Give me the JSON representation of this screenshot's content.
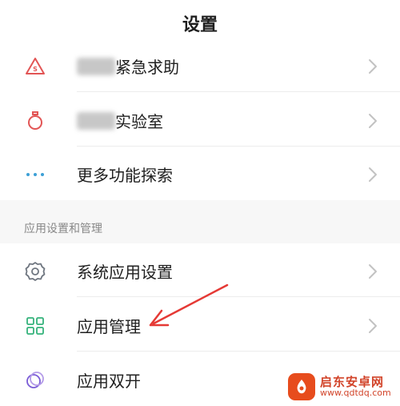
{
  "header": {
    "title": "设置"
  },
  "top_group": {
    "items": [
      {
        "label": "紧急求助",
        "icon": "sos-triangle-icon",
        "blurred_prefix": true
      },
      {
        "label": "实验室",
        "icon": "flask-icon",
        "blurred_prefix": true
      },
      {
        "label": "更多功能探索",
        "icon": "more-dots-icon",
        "blurred_prefix": false
      }
    ]
  },
  "app_section": {
    "title": "应用设置和管理",
    "items": [
      {
        "label": "系统应用设置",
        "icon": "gear-icon"
      },
      {
        "label": "应用管理",
        "icon": "grid-apps-icon"
      },
      {
        "label": "应用双开",
        "icon": "dual-circles-icon"
      }
    ]
  },
  "watermark": {
    "name": "启东安卓网",
    "url": "www.qdtdq.com"
  },
  "colors": {
    "accent_red": "#e25555",
    "dots_blue": "#3da0d6",
    "icon_gray": "#6f7680",
    "grid_green": "#34b27b",
    "dual_purple": "#7a5cd6",
    "chevron": "#c2c2c2",
    "section_bg": "#f7f7f7",
    "arrow_red": "#e53935"
  }
}
